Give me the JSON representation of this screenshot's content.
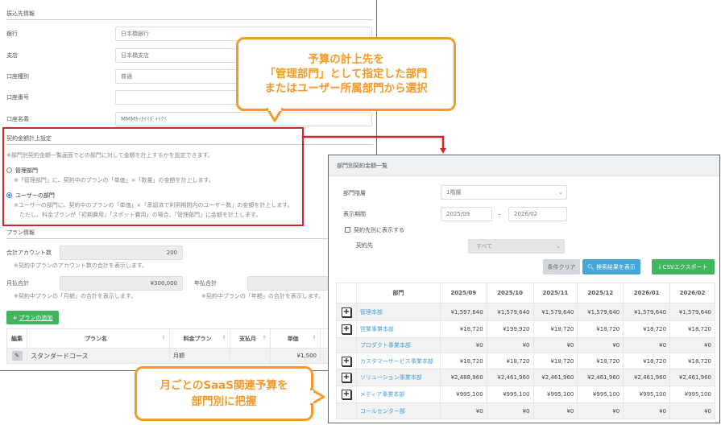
{
  "bank_section": {
    "title": "振込先情報",
    "rows": [
      {
        "label": "銀行",
        "value": "日本橋銀行"
      },
      {
        "label": "支店",
        "value": "日本橋支店"
      },
      {
        "label": "口座種別",
        "value": "普通"
      },
      {
        "label": "口座番号",
        "value": ""
      },
      {
        "label": "口座名義",
        "value": "MMMｶｯｶｲｲﾀﾞｲｲｸﾘ"
      }
    ]
  },
  "allocation_section": {
    "title": "契約金額計上設定",
    "note": "※部門別契約金額一覧画面でどの部門に対して金額を計上するかを設定できます。",
    "options": [
      {
        "label": "管理部門",
        "checked": false,
        "notes": [
          "※「管理部門」に、契約中のプランの「単価」×「数量」の金額を計上します。"
        ]
      },
      {
        "label": "ユーザーの部門",
        "checked": true,
        "notes": [
          "※ユーザーの部門に、契約中のプランの「単価」×「承認済で利用期間内のユーザー数」の金額を計上します。",
          "ただし、料金プランが「初期費用」「スポット費用」の場合、「管理部門」に金額を計上します。"
        ]
      }
    ]
  },
  "plan_section": {
    "title": "プラン情報",
    "account_total": {
      "label": "合計アカウント数",
      "value": "200",
      "note": "※契約中プランのアカウント数の合計を表示します。"
    },
    "monthly_total": {
      "label": "月払合計",
      "value": "¥300,000",
      "note": "※契約中プランの「月額」の合計を表示します。"
    },
    "yearly_total": {
      "label": "年払合計",
      "value": "",
      "note": "※契約中プランの「年額」の合計を表示します。"
    },
    "add_button": "プランの追加",
    "table": {
      "headers": [
        "編集",
        "プラン名",
        "料金プラン",
        "支払月",
        "単価"
      ],
      "rows": [
        {
          "name": "スタンダードコース",
          "plan": "月額",
          "month": "",
          "price": "¥1,500"
        }
      ]
    }
  },
  "dept_panel": {
    "title": "部門別契約金額一覧",
    "hierarchy": {
      "label": "部門階層",
      "value": "1階層"
    },
    "period": {
      "label": "表示期間",
      "from": "2025/09",
      "to": "2026/02",
      "sep": "–"
    },
    "by_contractor": {
      "label": "契約先別に表示する",
      "checked": false
    },
    "contractor": {
      "label": "契約先",
      "value": "すべて"
    },
    "buttons": {
      "clear": "条件クリア",
      "search": "検索結果を表示",
      "csv": "CSVエクスポート"
    },
    "table": {
      "headers": [
        "部門",
        "2025/09",
        "2025/10",
        "2025/11",
        "2025/12",
        "2026/01",
        "2026/02"
      ],
      "rows": [
        {
          "expand": true,
          "name": "管理本部",
          "values": [
            "¥1,597,640",
            "¥1,579,640",
            "¥1,579,640",
            "¥1,579,640",
            "¥1,579,640",
            "¥1,579,640"
          ]
        },
        {
          "expand": true,
          "name": "営業事業本部",
          "values": [
            "¥18,720",
            "¥199,920",
            "¥18,720",
            "¥18,720",
            "¥18,720",
            "¥18,720"
          ]
        },
        {
          "expand": false,
          "name": "プロダクト事業本部",
          "values": [
            "¥0",
            "¥0",
            "¥0",
            "¥0",
            "¥0",
            "¥0"
          ]
        },
        {
          "expand": true,
          "name": "カスタマーサービス事業本部",
          "values": [
            "¥18,720",
            "¥18,720",
            "¥18,720",
            "¥18,720",
            "¥18,720",
            "¥18,720"
          ]
        },
        {
          "expand": true,
          "name": "ソリューション事業本部",
          "values": [
            "¥2,488,960",
            "¥2,461,960",
            "¥2,461,960",
            "¥2,461,960",
            "¥2,461,960",
            "¥2,461,960"
          ]
        },
        {
          "expand": true,
          "name": "メディア事業本部",
          "values": [
            "¥995,100",
            "¥995,100",
            "¥995,100",
            "¥995,100",
            "¥995,100",
            "¥995,100"
          ]
        },
        {
          "expand": false,
          "name": "コールセンター部",
          "values": [
            "¥0",
            "¥0",
            "¥0",
            "¥0",
            "¥0",
            "¥0"
          ]
        }
      ]
    }
  },
  "callouts": {
    "top": [
      "予算の計上先を",
      "「管理部門」として指定した部門",
      "またはユーザー所属部門から選択"
    ],
    "bottom": [
      "月ごとのSaaS関連予算を",
      "部門別に把握"
    ]
  },
  "colors": {
    "accent_orange": "#f39a2b",
    "highlight_red": "#d9232a",
    "green": "#3fb55d",
    "blue": "#45a6d8",
    "link": "#4aa0d5"
  }
}
